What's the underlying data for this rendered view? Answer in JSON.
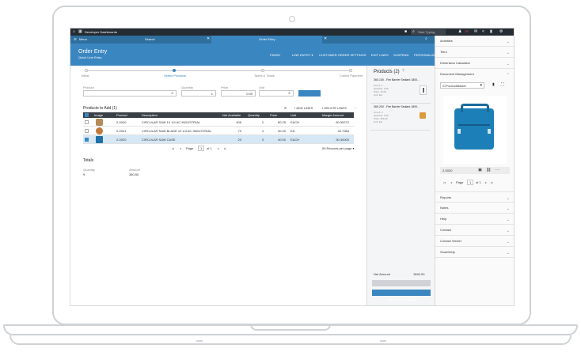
{
  "app": {
    "title": "Developer Dashboards",
    "search_placeholder": "Start Typing",
    "user_initials": "JS"
  },
  "tabs": [
    {
      "label": "Menu"
    },
    {
      "label": "Search"
    },
    {
      "label": "Order Entry"
    }
  ],
  "header": {
    "title": "Order Entry",
    "subtitle": "Quick Line Entry",
    "actions": [
      "FINISH",
      "LINE ENTRY ▾",
      "CUSTOMER ORDER SETTINGS",
      "EDIT LINES",
      "SUSPEND",
      "PERSONALIZE"
    ]
  },
  "steps": [
    {
      "label": "Initial",
      "active": false
    },
    {
      "label": "Select Products",
      "active": true
    },
    {
      "label": "Taxes & Totals",
      "active": false
    },
    {
      "label": "Collect Payment",
      "active": false
    }
  ],
  "form": {
    "product_label": "Product",
    "quantity_label": "Quantity",
    "quantity_value": "1",
    "price_label": "Price",
    "price_value": "0.00",
    "unit_label": "Unit",
    "add_button": "ADD"
  },
  "table": {
    "title": "Products to Add (1)",
    "add_lines": "ADD LINES",
    "delete_lines": "DELETE LINES",
    "columns": [
      "Image",
      "Product",
      "Description",
      "Net Available",
      "Quantity",
      "Price",
      "Unit",
      "Margin Amount"
    ],
    "rows": [
      {
        "product": "2-0040",
        "description": "CIRCULAR SAW 10 1/4 AC INDUSTRIAL",
        "available": "406",
        "quantity": "2",
        "price": "80.25",
        "unit": "EACH",
        "margin": "60.55272",
        "checked": false
      },
      {
        "product": "2-0041",
        "description": "CIRCULAR SAW BLADE 10 1/4 AC INDUSTRIAL",
        "available": "70",
        "quantity": "4",
        "price": "30.00",
        "unit": "EA",
        "margin": "40.7984",
        "checked": false
      },
      {
        "product": "2-0020",
        "description": "CIRCULAR SAW CASE",
        "available": "20",
        "quantity": "3",
        "price": "40.00",
        "unit": "EACH",
        "margin": "30.40000",
        "checked": true
      }
    ],
    "page_label": "Page",
    "page_value": "1",
    "page_of": "of 1",
    "records": "50 Records per page ▾"
  },
  "totals": {
    "title": "Totals",
    "quantity_label": "Quantity",
    "quantity_value": "9",
    "amount_label": "Amount",
    "amount_value": "380.50"
  },
  "products_panel": {
    "title": "Products (2)",
    "items": [
      {
        "title": "360-100 - Fire Barrier Sealant 1800...",
        "lines": [
          "Line #: 1",
          "Quantity: 2.00",
          "Price: 16.00",
          "Unit: EA"
        ]
      },
      {
        "title": "360-200 - Fire Barrier Sealant 1800...",
        "lines": [
          "Line #: 2",
          "Quantity: 2.00",
          "Price: 206.00",
          "Unit: EA"
        ]
      }
    ],
    "net_amount_label": "Net Amount",
    "net_amount_value": "1840.00",
    "edit_lines": "EDIT LINES",
    "collect_payment": "COLLECT PAYMENT"
  },
  "sidebar": {
    "sections_top": [
      "Activities",
      "Tiers",
      "Dimension Calculator",
      "Document Management"
    ],
    "doc_select": "ICProductMaster",
    "doc_caption": "2-0020",
    "doc_page": "Page",
    "doc_page_value": "1",
    "doc_page_of": "of 1",
    "sections_bottom": [
      "Reports",
      "Notes",
      "Help",
      "Contact",
      "Contact Viewer",
      "SmartHelp"
    ]
  },
  "colors": {
    "accent": "#3a86c1",
    "topbar": "#252b33"
  }
}
